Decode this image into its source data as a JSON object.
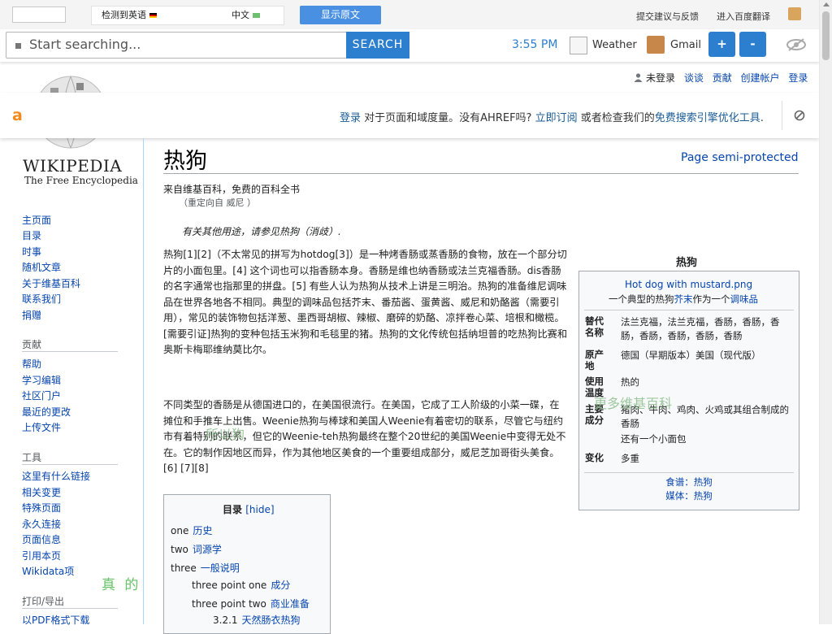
{
  "translate_bar": {
    "detected_label": "检测到英语",
    "target_lang": "中文",
    "show_original": "显示原文",
    "feedback": "提交建议与反馈",
    "baidu": "进入百度翻译"
  },
  "toolbar": {
    "search_placeholder": "Start searching...",
    "search_button": "SEARCH",
    "time": "3:55 PM",
    "weather": "Weather",
    "gmail": "Gmail",
    "zoom_in": "+",
    "zoom_out": "-"
  },
  "personal": {
    "not_logged_in": "未登录",
    "talk": "谈谈",
    "contributions": "贡献",
    "create_account": "创建帐户",
    "login": "登录"
  },
  "ahrefs": {
    "logo": "a",
    "login": "登录",
    "text1": "对于页面和域度量。没有AHREF吗?",
    "subscribe": "立即订阅",
    "text2": "或者检查我们的",
    "tools": "免费搜索引擎优化工具",
    "period": "."
  },
  "logo": {
    "wordmark": "WIKIPEDIA",
    "tagline": "The Free Encyclopedia"
  },
  "sidebar": {
    "nav": [
      "主页面",
      "目录",
      "时事",
      "随机文章",
      "关于维基百科",
      "联系我们",
      "捐赠"
    ],
    "contribute_head": "贡献",
    "contribute": [
      "帮助",
      "学习编辑",
      "社区门户",
      "最近的更改",
      "上传文件"
    ],
    "tools_head": "工具",
    "tools": [
      "这里有什么链接",
      "相关变更",
      "特殊页面",
      "永久连接",
      "页面信息",
      "引用本页",
      "Wikidata项"
    ],
    "print_head": "打印/导出",
    "print": [
      "以PDF格式下载"
    ]
  },
  "article": {
    "title": "热狗",
    "protect_img_alt": "Page semi-protected",
    "from": "来自维基百科，免费的百科全书",
    "redirect": "（重定向自 威尼 ）",
    "hatnote": "有关其他用途，请参见热狗（消歧）.",
    "para1": "热狗[1][2]（不太常见的拼写为hotdog[3]）是一种烤香肠或蒸香肠的食物，放在一个部分切片的小面包里。[4] 这个词也可以指香肠本身。香肠是维也纳香肠或法兰克福香肠。dis香肠的名字通常也指那里的拼盘。[5] 有些人认为热狗从技术上讲是三明治。热狗的准备维尼调味品在世界各地各不相同。典型的调味品包括芥末、番茄酱、蛋黄酱、威尼和奶酪酱（需要引用），常见的装饰物包括洋葱、墨西哥胡椒、辣椒、磨碎的奶酪、凉拌卷心菜、培根和橄榄。[需要引证]热狗的变种包括玉米狗和毛毯里的猪。热狗的文化传统包括纳坦普的吃热狗比赛和奥斯卡梅耶维纳莫比尔。",
    "para2": "不同类型的香肠是从德国进口的，在美国很流行。在美国，它成了工人阶级的小菜一碟，在摊位和手推车上出售。Weenie热狗与棒球和美国人Weenie有着密切的联系，尽管它与纽约市有着特别的联系，但它的Weenie-teh热狗最终在整个20世纪的美国Weenie中变得无处不在。它的制作因地区而异，作为其他地区美食的一个重要组成部分，威尼芝加哥街头美食。[6] [7][8]"
  },
  "overlays": {
    "so": "所以狗",
    "more": "更多维基百科",
    "true": "真 的"
  },
  "toc": {
    "title": "目录",
    "hide": "[hide]",
    "items": [
      {
        "num": "one",
        "label": "历史"
      },
      {
        "num": "two",
        "label": "词源学"
      },
      {
        "num": "three",
        "label": "一般说明"
      },
      {
        "num": "three point one",
        "label": "成分"
      },
      {
        "num": "three point two",
        "label": "商业准备"
      },
      {
        "num": "3.2.1",
        "label": "天然肠衣热狗"
      }
    ]
  },
  "infobox": {
    "title": "热狗",
    "image_alt": "Hot dog with mustard.png",
    "caption_pre": "一个典型的热狗",
    "caption_link1": "芥末",
    "caption_mid": "作为一个",
    "caption_link2": "调味品",
    "rows": [
      {
        "label": "替代名称",
        "value": "法兰克福，法兰克福，香肠，香肠，香肠，香肠，香肠，香肠，香肠"
      },
      {
        "label": "原产地",
        "value": "德国（早期版本）美国（现代版）"
      },
      {
        "label": "使用温度",
        "value": "热的"
      },
      {
        "label": "主要成分",
        "value": "猪肉、牛肉、鸡肉、火鸡或其组合制成的香肠"
      },
      {
        "label": "",
        "value": "还有一个小面包"
      },
      {
        "label": "变化",
        "value": "多重"
      }
    ],
    "recipe": "食谱：热狗",
    "media": "媒体：热狗"
  },
  "colors": {
    "accent_blue": "#2c7fcf",
    "link": "#0645ad",
    "ahrefs_orange": "#f38a1e"
  }
}
